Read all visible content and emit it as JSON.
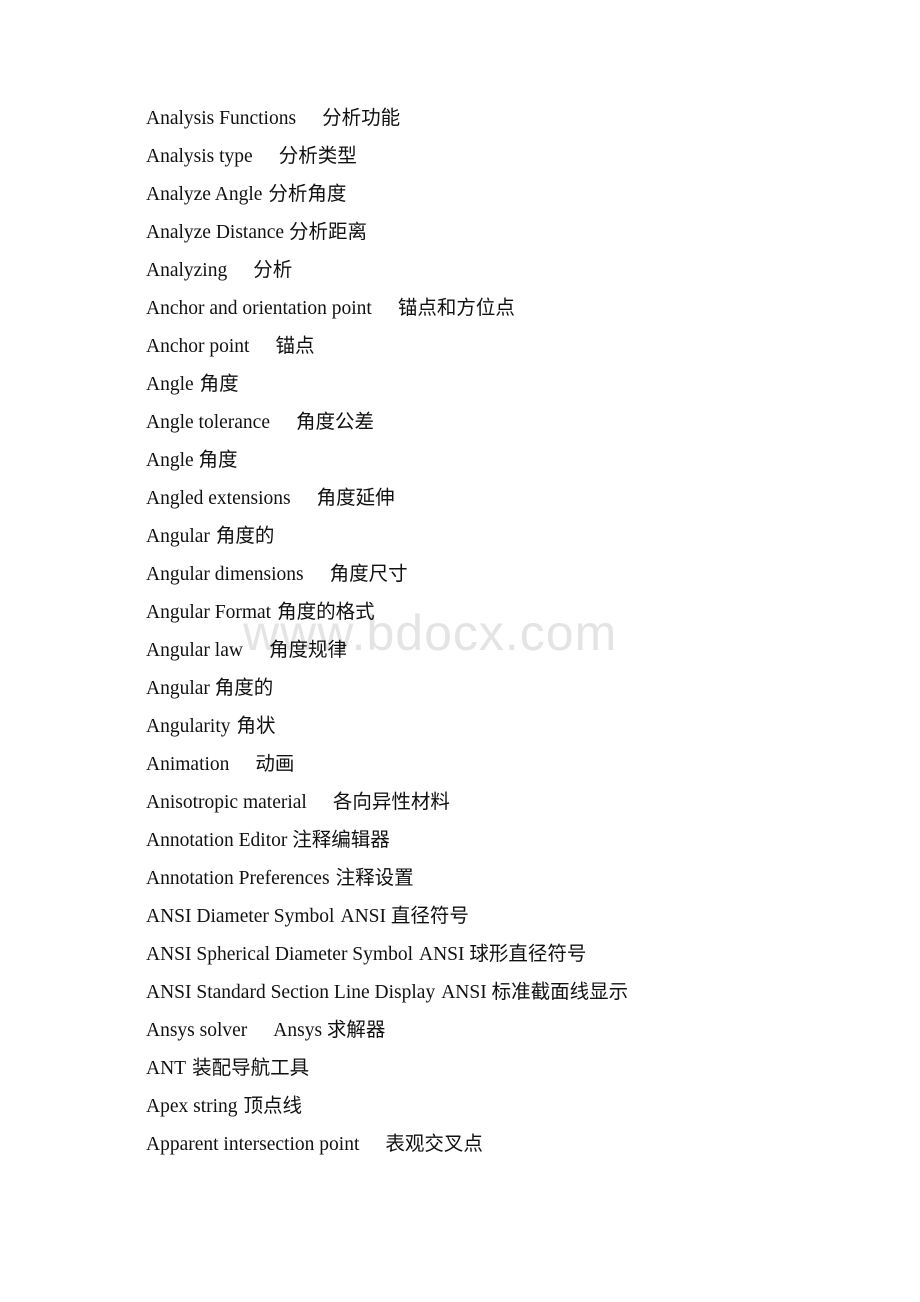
{
  "document": {
    "type": "bilingual-glossary",
    "background_color": "#ffffff",
    "text_color": "#111111"
  },
  "watermark": {
    "text": "www.bdocx.com",
    "color": "#e4e4e4"
  },
  "glossary": {
    "entries": [
      {
        "term": "Analysis Functions",
        "gap": "wide",
        "gloss": "分析功能"
      },
      {
        "term": "Analysis type",
        "gap": "wide",
        "gloss": "分析类型"
      },
      {
        "term": "Analyze Angle",
        "gap": "thin",
        "gloss": "分析角度"
      },
      {
        "term": "Analyze Distance",
        "gap": "none",
        "gloss": "分析距离"
      },
      {
        "term": "Analyzing",
        "gap": "wide",
        "gloss": "分析"
      },
      {
        "term": "Anchor and orientation point",
        "gap": "wide",
        "gloss": "锚点和方位点"
      },
      {
        "term": "Anchor point",
        "gap": "wide",
        "gloss": "锚点"
      },
      {
        "term": "Angle",
        "gap": "thin",
        "gloss": "角度"
      },
      {
        "term": "Angle tolerance",
        "gap": "wide",
        "gloss": "角度公差"
      },
      {
        "term": "Angle",
        "gap": "none",
        "gloss": "角度"
      },
      {
        "term": "Angled extensions",
        "gap": "wide",
        "gloss": "角度延伸"
      },
      {
        "term": "Angular",
        "gap": "thin",
        "gloss": "角度的"
      },
      {
        "term": "Angular dimensions",
        "gap": "wide",
        "gloss": "角度尺寸"
      },
      {
        "term": "Angular Format",
        "gap": "thin",
        "gloss": "角度的格式"
      },
      {
        "term": "Angular law",
        "gap": "wide",
        "gloss": "角度规律"
      },
      {
        "term": "Angular",
        "gap": "none",
        "gloss": "角度的"
      },
      {
        "term": "Angularity",
        "gap": "thin",
        "gloss": "角状"
      },
      {
        "term": "Animation",
        "gap": "wide",
        "gloss": "动画"
      },
      {
        "term": "Anisotropic material",
        "gap": "wide",
        "gloss": "各向异性材料"
      },
      {
        "term": "Annotation Editor",
        "gap": "none",
        "gloss": "注释编辑器"
      },
      {
        "term": "Annotation Preferences",
        "gap": "thin",
        "gloss": "注释设置"
      },
      {
        "term": "ANSI Diameter Symbol",
        "gap": "thin",
        "gloss": "ANSI 直径符号"
      },
      {
        "term": "ANSI Spherical Diameter Symbol",
        "gap": "thin",
        "gloss": "ANSI 球形直径符号"
      },
      {
        "term": "ANSI Standard Section Line Display",
        "gap": "thin",
        "gloss": "ANSI 标准截面线显示"
      },
      {
        "term": "Ansys solver",
        "gap": "wide",
        "gloss": "Ansys 求解器"
      },
      {
        "term": "ANT",
        "gap": "thin",
        "gloss": "装配导航工具"
      },
      {
        "term": "Apex string",
        "gap": "thin",
        "gloss": "顶点线"
      },
      {
        "term": "Apparent intersection point",
        "gap": "wide",
        "gloss": "表观交叉点"
      }
    ]
  }
}
